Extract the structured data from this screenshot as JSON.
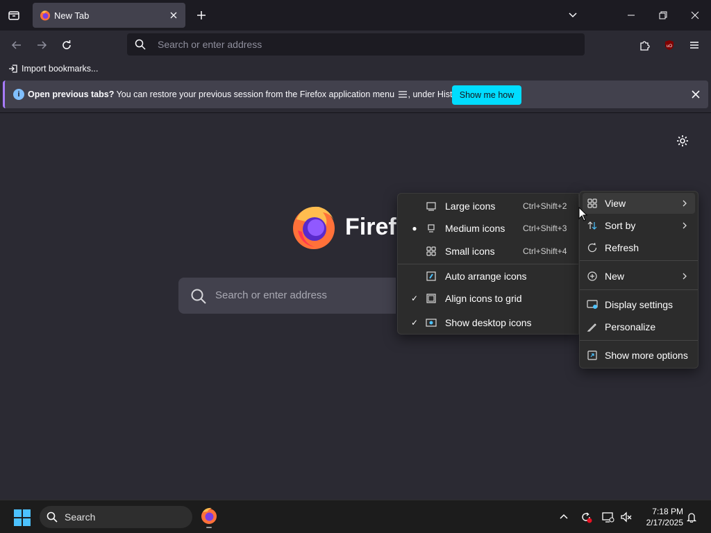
{
  "browser": {
    "tab": {
      "title": "New Tab"
    },
    "urlbar": {
      "placeholder": "Search or enter address"
    },
    "bookmarks": {
      "import_label": "Import bookmarks..."
    },
    "infobar": {
      "bold_text": "Open previous tabs?",
      "text_before_icon": "You can restore your previous session from the Firefox application menu",
      "text_after_icon": ", under History.",
      "button_label": "Show me how"
    }
  },
  "newtab": {
    "brand": "Firefox",
    "search_placeholder": "Search or enter address"
  },
  "view_submenu": {
    "items": [
      {
        "label": "Large icons",
        "shortcut": "Ctrl+Shift+2",
        "icon": "large-icons-icon",
        "selected": false
      },
      {
        "label": "Medium icons",
        "shortcut": "Ctrl+Shift+3",
        "icon": "medium-icons-icon",
        "selected": true
      },
      {
        "label": "Small icons",
        "shortcut": "Ctrl+Shift+4",
        "icon": "small-icons-icon",
        "selected": false
      },
      {
        "label": "Auto arrange icons",
        "icon": "auto-arrange-icon",
        "checked": false
      },
      {
        "label": "Align icons to grid",
        "icon": "align-grid-icon",
        "checked": true
      },
      {
        "label": "Show desktop icons",
        "icon": "show-desktop-icon",
        "checked": true
      }
    ]
  },
  "context_menu": {
    "items": [
      {
        "label": "View",
        "icon": "grid-icon",
        "has_submenu": true
      },
      {
        "label": "Sort by",
        "icon": "sort-icon",
        "has_submenu": true
      },
      {
        "label": "Refresh",
        "icon": "refresh-icon",
        "has_submenu": false
      },
      {
        "label": "New",
        "icon": "plus-circle-icon",
        "has_submenu": true
      },
      {
        "label": "Display settings",
        "icon": "display-icon",
        "has_submenu": false
      },
      {
        "label": "Personalize",
        "icon": "pen-icon",
        "has_submenu": false
      },
      {
        "label": "Show more options",
        "icon": "more-options-icon",
        "has_submenu": false
      }
    ]
  },
  "taskbar": {
    "search_label": "Search",
    "time": "7:18 PM",
    "date": "2/17/2025"
  },
  "colors": {
    "accent": "#00ddff",
    "toolbar_bg": "#2b2a33",
    "tabbar_bg": "#1c1b22",
    "menu_bg": "#2c2c2c",
    "infobar_border": "#a77bff"
  }
}
